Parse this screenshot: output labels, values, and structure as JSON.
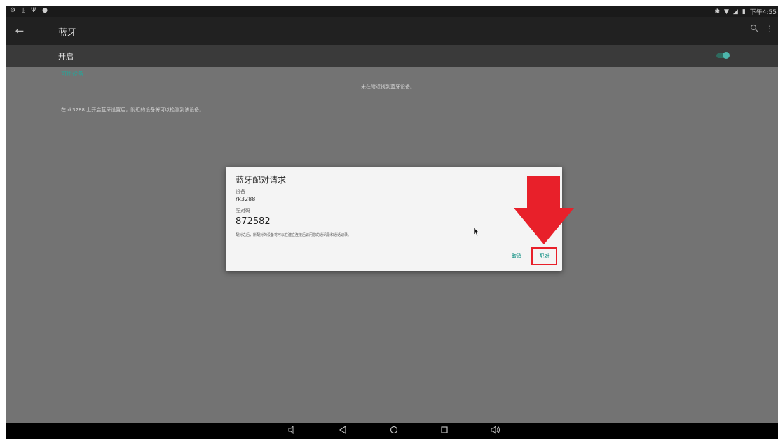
{
  "status_bar": {
    "left_icons": [
      "settings-icon",
      "download-icon",
      "usb-icon",
      "pin-icon"
    ],
    "right_icons": [
      "bluetooth-icon",
      "wifi-icon",
      "signal-icon",
      "battery-icon"
    ],
    "time": "下午4:55"
  },
  "app_bar": {
    "title": "蓝牙",
    "back_icon": "back-arrow-icon",
    "search_icon": "search-icon",
    "more_icon": "more-vert-icon"
  },
  "switch_bar": {
    "label": "开启",
    "enabled": true,
    "accent_color": "#4db6ac"
  },
  "content": {
    "section_header": "可用设备",
    "empty_message": "未在附近找到蓝牙设备。",
    "hint": "在 rk3288 上开启蓝牙设置后，附近的设备将可以检测到该设备。"
  },
  "dialog": {
    "title": "蓝牙配对请求",
    "device_label": "设备",
    "device_name": "rk3288",
    "code_label": "配对码",
    "code": "872582",
    "note": "配对之后，所配对的设备将可以在建立连接后访问您的通讯录和通话记录。",
    "cancel_label": "取消",
    "pair_label": "配对"
  },
  "annotation": {
    "highlight_color": "#e8202a"
  },
  "nav_bar": {
    "icons": [
      "volume-down-icon",
      "back-icon",
      "home-icon",
      "recents-icon",
      "volume-up-icon"
    ]
  }
}
